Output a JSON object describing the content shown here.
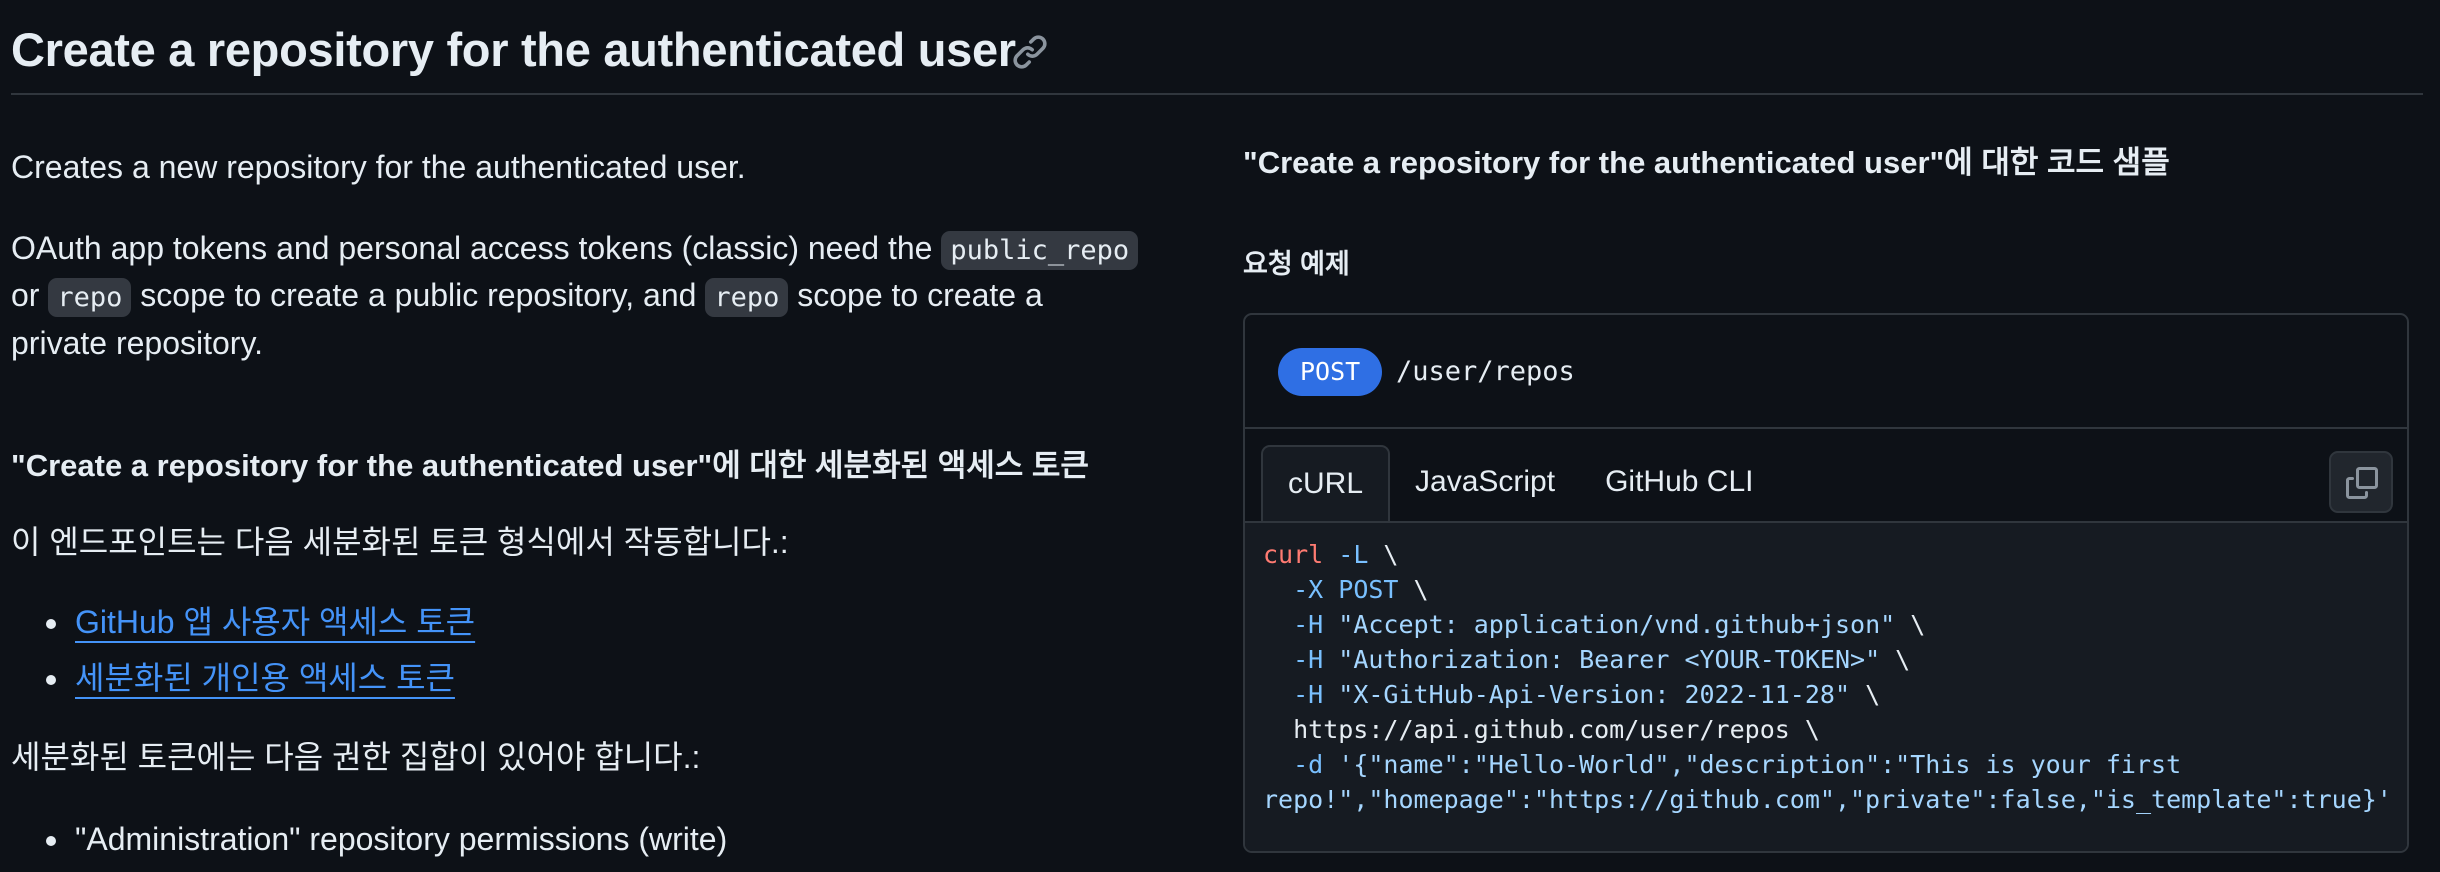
{
  "title": "Create a repository for the authenticated user",
  "intro": "Creates a new repository for the authenticated user.",
  "oauth": {
    "part1": "OAuth app tokens and personal access tokens (classic) need the ",
    "code1": "public_repo",
    "part2": "or ",
    "code2": "repo",
    "part3": " scope to create a public repository, and ",
    "code3": "repo",
    "part4": " scope to create a",
    "part5": "private repository."
  },
  "fine_grained_heading": "\"Create a repository for the authenticated user\"에 대한 세분화된 액세스 토큰",
  "fine_grained_intro": "이 엔드포인트는 다음 세분화된 토큰 형식에서 작동합니다.:",
  "token_types": [
    "GitHub 앱 사용자 액세스 토큰",
    "세분화된 개인용 액세스 토큰"
  ],
  "permissions_intro": "세분화된 토큰에는 다음 권한 집합이 있어야 합니다.:",
  "permissions": [
    "\"Administration\" repository permissions (write)"
  ],
  "code_samples": {
    "heading": "\"Create a repository for the authenticated user\"에 대한 코드 샘플",
    "request_label": "요청 예제",
    "method": "POST",
    "path": "/user/repos",
    "tabs": [
      "cURL",
      "JavaScript",
      "GitHub CLI"
    ],
    "active_tab": "cURL",
    "copy_icon": "copy-icon",
    "code": {
      "l1_cmd": "curl",
      "l1_flag": " -L",
      "l1_rest": " \\",
      "l2_indent": "  ",
      "l2_flag": "-X POST",
      "l2_rest": " \\",
      "l3_flag": "-H",
      "l3_str": " \"Accept: application/vnd.github+json\"",
      "l3_rest": " \\",
      "l4_flag": "-H",
      "l4_str": " \"Authorization: Bearer <YOUR-TOKEN>\"",
      "l4_rest": " \\",
      "l5_flag": "-H",
      "l5_str": " \"X-GitHub-Api-Version: 2022-11-28\"",
      "l5_rest": " \\",
      "l6": "  https://api.github.com/user/repos \\",
      "l7_flag": "-d",
      "l7_str": " '{\"name\":\"Hello-World\",\"description\":\"This is your first",
      "l8_str": "repo!\",\"homepage\":\"https://github.com\",\"private\":false,\"is_template\":true}'"
    }
  },
  "colors": {
    "background": "#0d1117",
    "link": "#4493f8",
    "method_badge": "#2f6fe4",
    "border": "#30363d"
  }
}
